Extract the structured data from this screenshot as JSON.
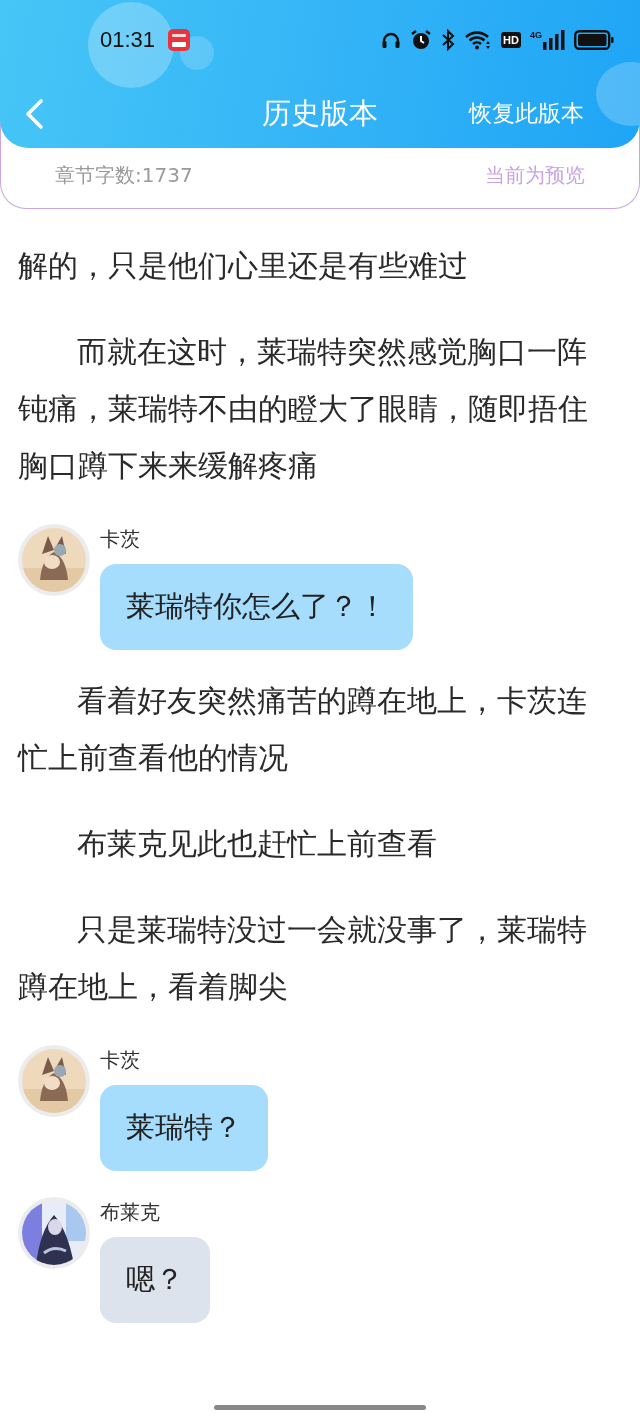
{
  "status_bar": {
    "time": "01:31",
    "hd": "HD",
    "network": "4G"
  },
  "nav": {
    "title": "历史版本",
    "action": "恢复此版本"
  },
  "info": {
    "word_count": "章节字数:1737",
    "mode": "当前为预览"
  },
  "content": [
    {
      "kind": "paragraph_tail",
      "text": "解的，只是他们心里还是有些难过"
    },
    {
      "kind": "paragraph",
      "text": "而就在这时，莱瑞特突然感觉胸口一阵钝痛，莱瑞特不由的瞪大了眼睛，随即捂住胸口蹲下来来缓解疼痛"
    },
    {
      "kind": "message",
      "speaker": "卡茨",
      "text": "莱瑞特你怎么了？！",
      "color": "#a6dcfc"
    },
    {
      "kind": "paragraph",
      "text": "看着好友突然痛苦的蹲在地上，卡茨连忙上前查看他的情况"
    },
    {
      "kind": "paragraph",
      "text": "布莱克见此也赶忙上前查看"
    },
    {
      "kind": "paragraph",
      "text": "只是莱瑞特没过一会就没事了，莱瑞特蹲在地上，看着脚尖"
    },
    {
      "kind": "message",
      "speaker": "卡茨",
      "text": "莱瑞特？",
      "color": "#a6dcfc"
    },
    {
      "kind": "message",
      "speaker": "布莱克",
      "text": "嗯？",
      "color": "#dde3ec"
    }
  ]
}
